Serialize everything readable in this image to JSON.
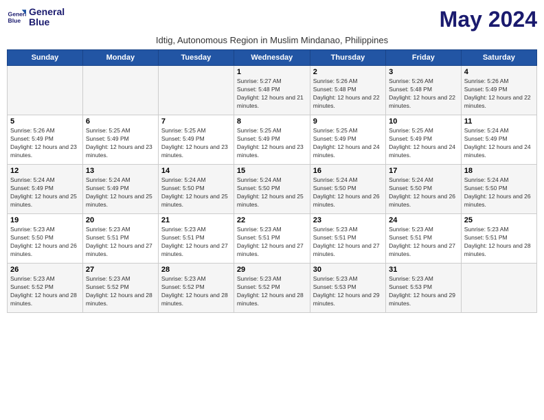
{
  "header": {
    "logo_line1": "General",
    "logo_line2": "Blue",
    "month_title": "May 2024",
    "subtitle": "Idtig, Autonomous Region in Muslim Mindanao, Philippines"
  },
  "weekdays": [
    "Sunday",
    "Monday",
    "Tuesday",
    "Wednesday",
    "Thursday",
    "Friday",
    "Saturday"
  ],
  "weeks": [
    [
      {
        "day": "",
        "sunrise": "",
        "sunset": "",
        "daylight": ""
      },
      {
        "day": "",
        "sunrise": "",
        "sunset": "",
        "daylight": ""
      },
      {
        "day": "",
        "sunrise": "",
        "sunset": "",
        "daylight": ""
      },
      {
        "day": "1",
        "sunrise": "5:27 AM",
        "sunset": "5:48 PM",
        "daylight": "12 hours and 21 minutes."
      },
      {
        "day": "2",
        "sunrise": "5:26 AM",
        "sunset": "5:48 PM",
        "daylight": "12 hours and 22 minutes."
      },
      {
        "day": "3",
        "sunrise": "5:26 AM",
        "sunset": "5:48 PM",
        "daylight": "12 hours and 22 minutes."
      },
      {
        "day": "4",
        "sunrise": "5:26 AM",
        "sunset": "5:49 PM",
        "daylight": "12 hours and 22 minutes."
      }
    ],
    [
      {
        "day": "5",
        "sunrise": "5:26 AM",
        "sunset": "5:49 PM",
        "daylight": "12 hours and 23 minutes."
      },
      {
        "day": "6",
        "sunrise": "5:25 AM",
        "sunset": "5:49 PM",
        "daylight": "12 hours and 23 minutes."
      },
      {
        "day": "7",
        "sunrise": "5:25 AM",
        "sunset": "5:49 PM",
        "daylight": "12 hours and 23 minutes."
      },
      {
        "day": "8",
        "sunrise": "5:25 AM",
        "sunset": "5:49 PM",
        "daylight": "12 hours and 23 minutes."
      },
      {
        "day": "9",
        "sunrise": "5:25 AM",
        "sunset": "5:49 PM",
        "daylight": "12 hours and 24 minutes."
      },
      {
        "day": "10",
        "sunrise": "5:25 AM",
        "sunset": "5:49 PM",
        "daylight": "12 hours and 24 minutes."
      },
      {
        "day": "11",
        "sunrise": "5:24 AM",
        "sunset": "5:49 PM",
        "daylight": "12 hours and 24 minutes."
      }
    ],
    [
      {
        "day": "12",
        "sunrise": "5:24 AM",
        "sunset": "5:49 PM",
        "daylight": "12 hours and 25 minutes."
      },
      {
        "day": "13",
        "sunrise": "5:24 AM",
        "sunset": "5:49 PM",
        "daylight": "12 hours and 25 minutes."
      },
      {
        "day": "14",
        "sunrise": "5:24 AM",
        "sunset": "5:50 PM",
        "daylight": "12 hours and 25 minutes."
      },
      {
        "day": "15",
        "sunrise": "5:24 AM",
        "sunset": "5:50 PM",
        "daylight": "12 hours and 25 minutes."
      },
      {
        "day": "16",
        "sunrise": "5:24 AM",
        "sunset": "5:50 PM",
        "daylight": "12 hours and 26 minutes."
      },
      {
        "day": "17",
        "sunrise": "5:24 AM",
        "sunset": "5:50 PM",
        "daylight": "12 hours and 26 minutes."
      },
      {
        "day": "18",
        "sunrise": "5:24 AM",
        "sunset": "5:50 PM",
        "daylight": "12 hours and 26 minutes."
      }
    ],
    [
      {
        "day": "19",
        "sunrise": "5:23 AM",
        "sunset": "5:50 PM",
        "daylight": "12 hours and 26 minutes."
      },
      {
        "day": "20",
        "sunrise": "5:23 AM",
        "sunset": "5:51 PM",
        "daylight": "12 hours and 27 minutes."
      },
      {
        "day": "21",
        "sunrise": "5:23 AM",
        "sunset": "5:51 PM",
        "daylight": "12 hours and 27 minutes."
      },
      {
        "day": "22",
        "sunrise": "5:23 AM",
        "sunset": "5:51 PM",
        "daylight": "12 hours and 27 minutes."
      },
      {
        "day": "23",
        "sunrise": "5:23 AM",
        "sunset": "5:51 PM",
        "daylight": "12 hours and 27 minutes."
      },
      {
        "day": "24",
        "sunrise": "5:23 AM",
        "sunset": "5:51 PM",
        "daylight": "12 hours and 27 minutes."
      },
      {
        "day": "25",
        "sunrise": "5:23 AM",
        "sunset": "5:51 PM",
        "daylight": "12 hours and 28 minutes."
      }
    ],
    [
      {
        "day": "26",
        "sunrise": "5:23 AM",
        "sunset": "5:52 PM",
        "daylight": "12 hours and 28 minutes."
      },
      {
        "day": "27",
        "sunrise": "5:23 AM",
        "sunset": "5:52 PM",
        "daylight": "12 hours and 28 minutes."
      },
      {
        "day": "28",
        "sunrise": "5:23 AM",
        "sunset": "5:52 PM",
        "daylight": "12 hours and 28 minutes."
      },
      {
        "day": "29",
        "sunrise": "5:23 AM",
        "sunset": "5:52 PM",
        "daylight": "12 hours and 28 minutes."
      },
      {
        "day": "30",
        "sunrise": "5:23 AM",
        "sunset": "5:53 PM",
        "daylight": "12 hours and 29 minutes."
      },
      {
        "day": "31",
        "sunrise": "5:23 AM",
        "sunset": "5:53 PM",
        "daylight": "12 hours and 29 minutes."
      },
      {
        "day": "",
        "sunrise": "",
        "sunset": "",
        "daylight": ""
      }
    ]
  ]
}
